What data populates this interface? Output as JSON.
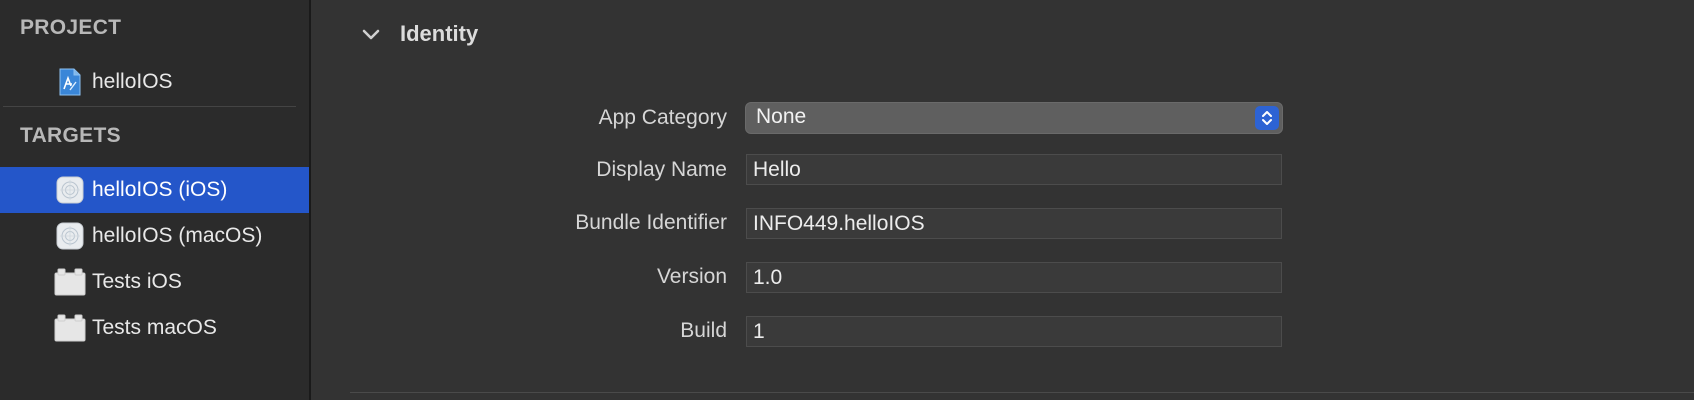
{
  "sidebar": {
    "project_header": "PROJECT",
    "project_item": {
      "label": "helloIOS",
      "icon": "project-file-icon"
    },
    "targets_header": "TARGETS",
    "targets": [
      {
        "label": "helloIOS (iOS)",
        "icon": "app-target-icon",
        "selected": true
      },
      {
        "label": "helloIOS (macOS)",
        "icon": "app-target-icon",
        "selected": false
      },
      {
        "label": "Tests iOS",
        "icon": "test-bundle-icon",
        "selected": false
      },
      {
        "label": "Tests macOS",
        "icon": "test-bundle-icon",
        "selected": false
      }
    ]
  },
  "identity": {
    "title": "Identity",
    "app_category_label": "App Category",
    "app_category_value": "None",
    "display_name_label": "Display Name",
    "display_name_value": "Hello",
    "bundle_id_label": "Bundle Identifier",
    "bundle_id_value": "INFO449.helloIOS",
    "version_label": "Version",
    "version_value": "1.0",
    "build_label": "Build",
    "build_value": "1"
  },
  "colors": {
    "selection": "#2456c9",
    "accent": "#2d63d4"
  }
}
